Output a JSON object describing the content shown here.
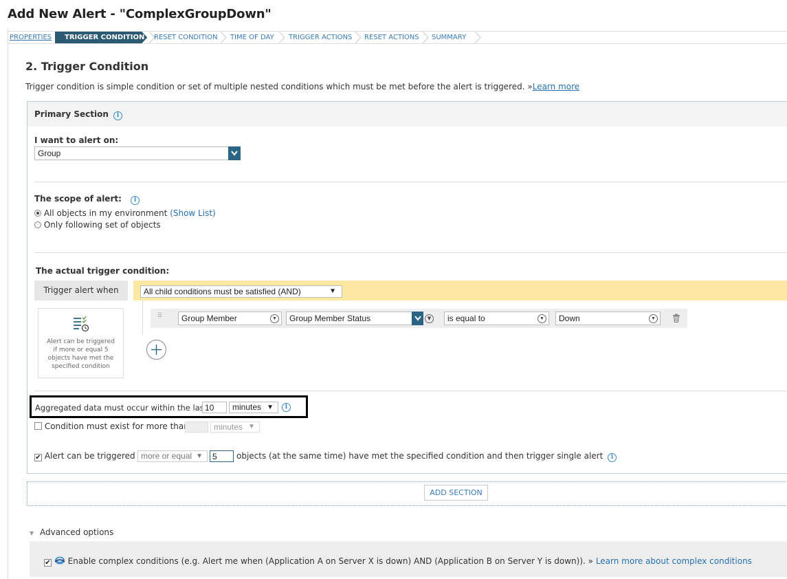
{
  "page": {
    "title": "Add New Alert - \"ComplexGroupDown\""
  },
  "breadcrumb": {
    "steps": [
      "PROPERTIES",
      "TRIGGER CONDITION",
      "RESET CONDITION",
      "TIME OF DAY",
      "TRIGGER ACTIONS",
      "RESET ACTIONS",
      "SUMMARY"
    ],
    "active": "TRIGGER CONDITION"
  },
  "heading": "2. Trigger Condition",
  "description": "Trigger condition is simple condition or set of multiple nested conditions which must be met before the alert is triggered. »",
  "learn_more": "Learn more",
  "primary_section": {
    "title": "Primary Section",
    "alert_on_label": "I want to alert on:",
    "alert_on_value": "Group",
    "scope_label": "The scope of alert:",
    "scope_all": "All objects in my environment",
    "show_list": "(Show List)",
    "scope_only": "Only following set of objects",
    "scope_selected": "all",
    "actual_trigger_label": "The actual trigger condition:",
    "trigger_when": "Trigger alert when",
    "logic_select": "All child conditions must be satisfied (AND)",
    "condition": {
      "field": "Group Member",
      "property": "Group Member Status",
      "operator": "is equal to",
      "value": "Down"
    },
    "hint_card": "Alert can be triggered if more or equal 5 objects have met the specified condition",
    "aggregate": {
      "label": "Aggregated data must occur within the last",
      "value": "10",
      "unit": "minutes"
    },
    "exist": {
      "label": "Condition must exist for more than",
      "value": "",
      "unit": "minutes",
      "checked": false
    },
    "trigger_if": {
      "label": "Alert can be triggered if",
      "comparator": "more or equal",
      "count": "5",
      "suffix": "objects (at the same time) have met the specified condition and then trigger single alert",
      "checked": true
    }
  },
  "add_section": "ADD SECTION",
  "advanced": {
    "label": "Advanced options",
    "complex_text": "Enable complex conditions (e.g. Alert me when (Application A on Server X is down) AND (Application B on Server Y is down)). »",
    "complex_link": "Learn more about complex conditions",
    "checked": true
  },
  "colors": {
    "accent": "#2d5a73",
    "link": "#2670b3",
    "highlight": "#fde8a3"
  },
  "icons": [
    "info-icon",
    "chevron-down-icon",
    "drag-handle-icon",
    "trash-icon",
    "add-circle-icon",
    "list-clock-icon",
    "triangle-down-icon",
    "app-icon"
  ]
}
